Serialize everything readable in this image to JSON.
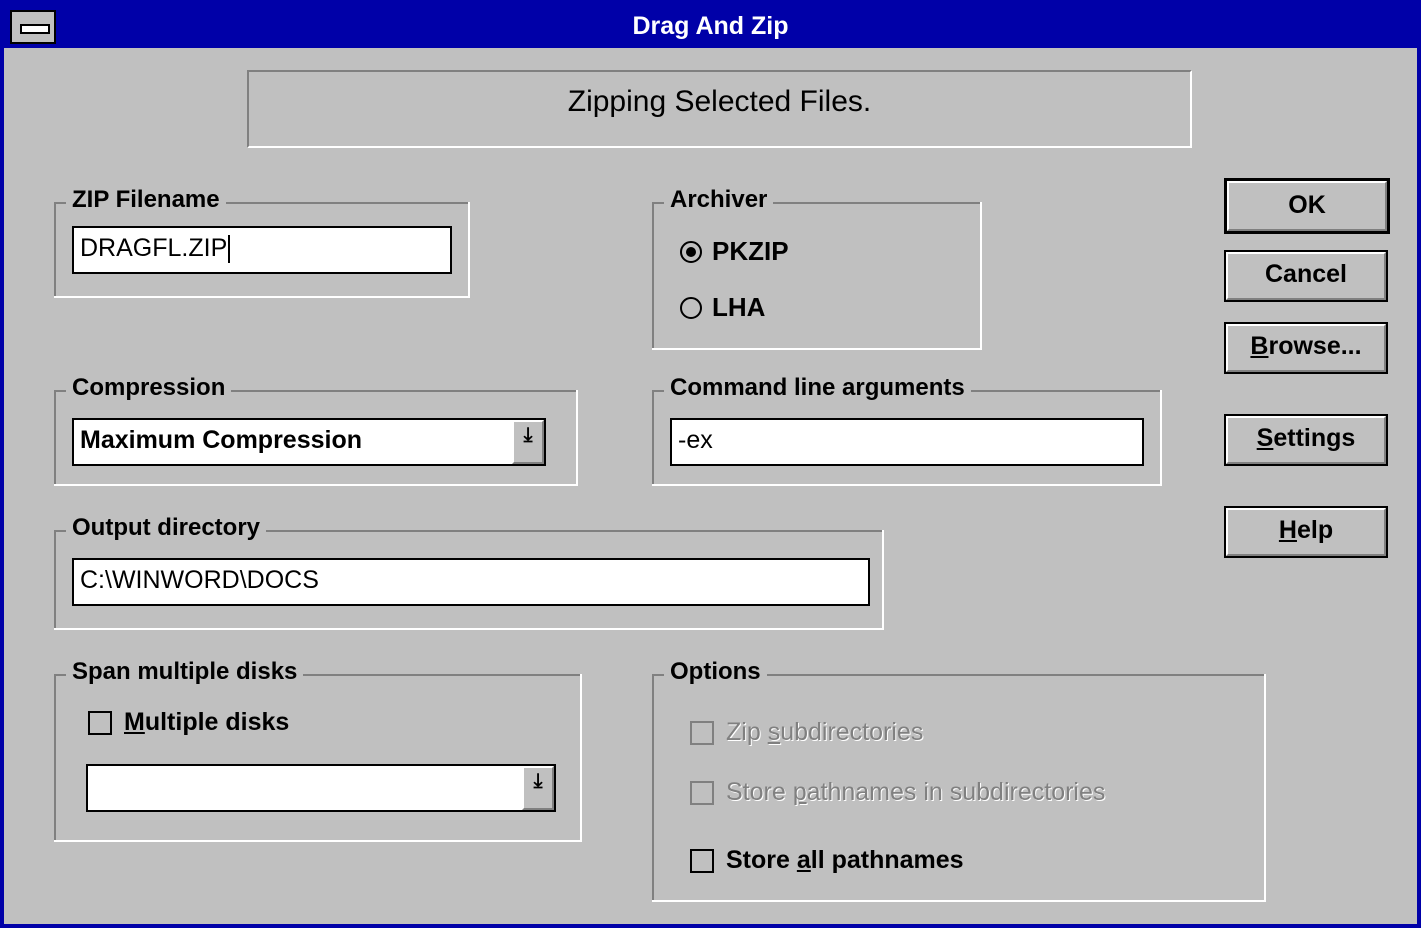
{
  "window": {
    "title": "Drag And Zip"
  },
  "status": {
    "message": "Zipping Selected Files."
  },
  "zip_filename": {
    "label": "ZIP Filename",
    "value": "DRAGFL.ZIP"
  },
  "archiver": {
    "label": "Archiver",
    "options": [
      {
        "label": "PKZIP",
        "selected": true
      },
      {
        "label": "LHA",
        "selected": false
      }
    ]
  },
  "compression": {
    "label": "Compression",
    "value": "Maximum Compression"
  },
  "command_line": {
    "label": "Command line arguments",
    "value": "-ex"
  },
  "output_directory": {
    "label": "Output directory",
    "value": "C:\\WINWORD\\DOCS"
  },
  "span": {
    "label": "Span multiple disks",
    "checkbox_prefix": "",
    "checkbox_mnemonic": "M",
    "checkbox_rest": "ultiple disks",
    "checked": false,
    "drive_value": ""
  },
  "options": {
    "label": "Options",
    "zip_subdirs": {
      "pre": "Zip ",
      "mn": "s",
      "post": "ubdirectories",
      "enabled": false
    },
    "store_pathnames_subdirs": {
      "pre": "Store ",
      "mn": "p",
      "post": "athnames in subdirectories",
      "enabled": false
    },
    "store_all_pathnames": {
      "pre": "Store ",
      "mn": "a",
      "post": "ll pathnames",
      "enabled": true
    }
  },
  "buttons": {
    "ok": "OK",
    "cancel": "Cancel",
    "browse": {
      "mn": "B",
      "rest": "rowse..."
    },
    "settings": {
      "mn": "S",
      "rest": "ettings"
    },
    "help": {
      "mn": "H",
      "rest": "elp"
    }
  },
  "icons": {
    "system_menu": "system-menu-icon",
    "combo_arrow": "down-arrow-icon"
  }
}
